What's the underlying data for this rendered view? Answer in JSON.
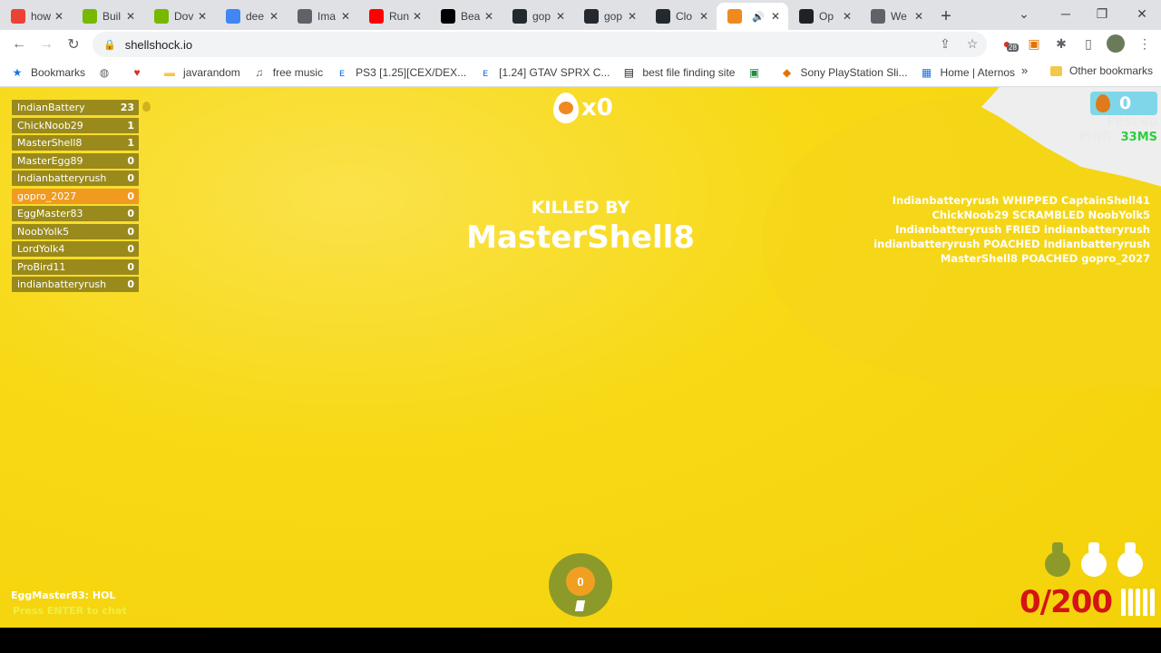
{
  "browser": {
    "tabs": [
      {
        "title": "how",
        "icon": "google-g-colored-icon",
        "color": "#ea4335"
      },
      {
        "title": "Buil",
        "icon": "nvidia-icon",
        "color": "#76b900"
      },
      {
        "title": "Dov",
        "icon": "nvidia-icon",
        "color": "#76b900"
      },
      {
        "title": "dee",
        "icon": "google-icon",
        "color": "#4285f4"
      },
      {
        "title": "Ima",
        "icon": "chart-icon",
        "color": "#5f6368"
      },
      {
        "title": "Run",
        "icon": "youtube-icon",
        "color": "#ff0000"
      },
      {
        "title": "Bea",
        "icon": "medium-icon",
        "color": "#000000"
      },
      {
        "title": "gop",
        "icon": "github-icon",
        "color": "#24292e"
      },
      {
        "title": "gop",
        "icon": "github-icon",
        "color": "#24292e"
      },
      {
        "title": "Clo",
        "icon": "github-icon",
        "color": "#24292e"
      },
      {
        "title": "",
        "icon": "shellshock-icon",
        "color": "#f08a20",
        "active": true
      },
      {
        "title": "Op",
        "icon": "openai-icon",
        "color": "#202124"
      },
      {
        "title": "We",
        "icon": "globe-icon",
        "color": "#5f6368"
      }
    ],
    "new_tab": "+",
    "url": "shellshock.io",
    "extension_badge": "28",
    "bookmarks": [
      {
        "label": "Bookmarks",
        "icon": "star-icon"
      },
      {
        "label": "",
        "icon": "globe-icon"
      },
      {
        "label": "",
        "icon": "heart-icon"
      },
      {
        "label": "javarandom",
        "icon": "folder-icon"
      },
      {
        "label": "free music",
        "icon": "music-icon"
      },
      {
        "label": "PS3 [1.25][CEX/DEX...",
        "icon": "e-icon"
      },
      {
        "label": "[1.24] GTAV SPRX C...",
        "icon": "e-icon"
      },
      {
        "label": "best file finding site",
        "icon": "printer-icon"
      },
      {
        "label": "",
        "icon": "app-icon"
      },
      {
        "label": "Sony PlayStation Sli...",
        "icon": "bag-icon"
      },
      {
        "label": "Home | Aternos",
        "icon": "aternos-icon"
      }
    ],
    "more_bookmarks": "»",
    "other_bookmarks": "Other bookmarks"
  },
  "game": {
    "leaderboard": [
      {
        "name": "IndianBattery",
        "score": "23"
      },
      {
        "name": "ChickNoob29",
        "score": "1"
      },
      {
        "name": "MasterShell8",
        "score": "1"
      },
      {
        "name": "MasterEgg89",
        "score": "0"
      },
      {
        "name": "Indianbatteryrush",
        "score": "0"
      },
      {
        "name": "gopro_2027",
        "score": "0",
        "me": true
      },
      {
        "name": "EggMaster83",
        "score": "0"
      },
      {
        "name": "NoobYolk5",
        "score": "0"
      },
      {
        "name": "LordYolk4",
        "score": "0"
      },
      {
        "name": "ProBird11",
        "score": "0"
      },
      {
        "name": "indianbatteryrush",
        "score": "0"
      }
    ],
    "kill_streak": "x0",
    "killed_by_label": "KILLED BY",
    "killer": "MasterShell8",
    "kill_feed": [
      "Indianbatteryrush WHIPPED CaptainShell41",
      "ChickNoob29 SCRAMBLED NoobYolk5",
      "Indianbatteryrush FRIED indianbatteryrush",
      "indianbatteryrush POACHED Indianbatteryrush",
      "MasterShell8 POACHED gopro_2027"
    ],
    "coins": "0",
    "fps_label": "FPS: 60",
    "ping_label": "PING:",
    "ping_value": "33MS",
    "chat_message": "EggMaster83: HOL",
    "chat_hint": "Press ENTER to chat",
    "grenade_center_count": "0",
    "ammo": "0/200",
    "colors": {
      "background": "#f7d916",
      "leaderboard_row": "#9a8a1c",
      "leaderboard_me": "#f09a20",
      "ammo": "#d41414",
      "ping_good": "#2ecc40"
    }
  }
}
